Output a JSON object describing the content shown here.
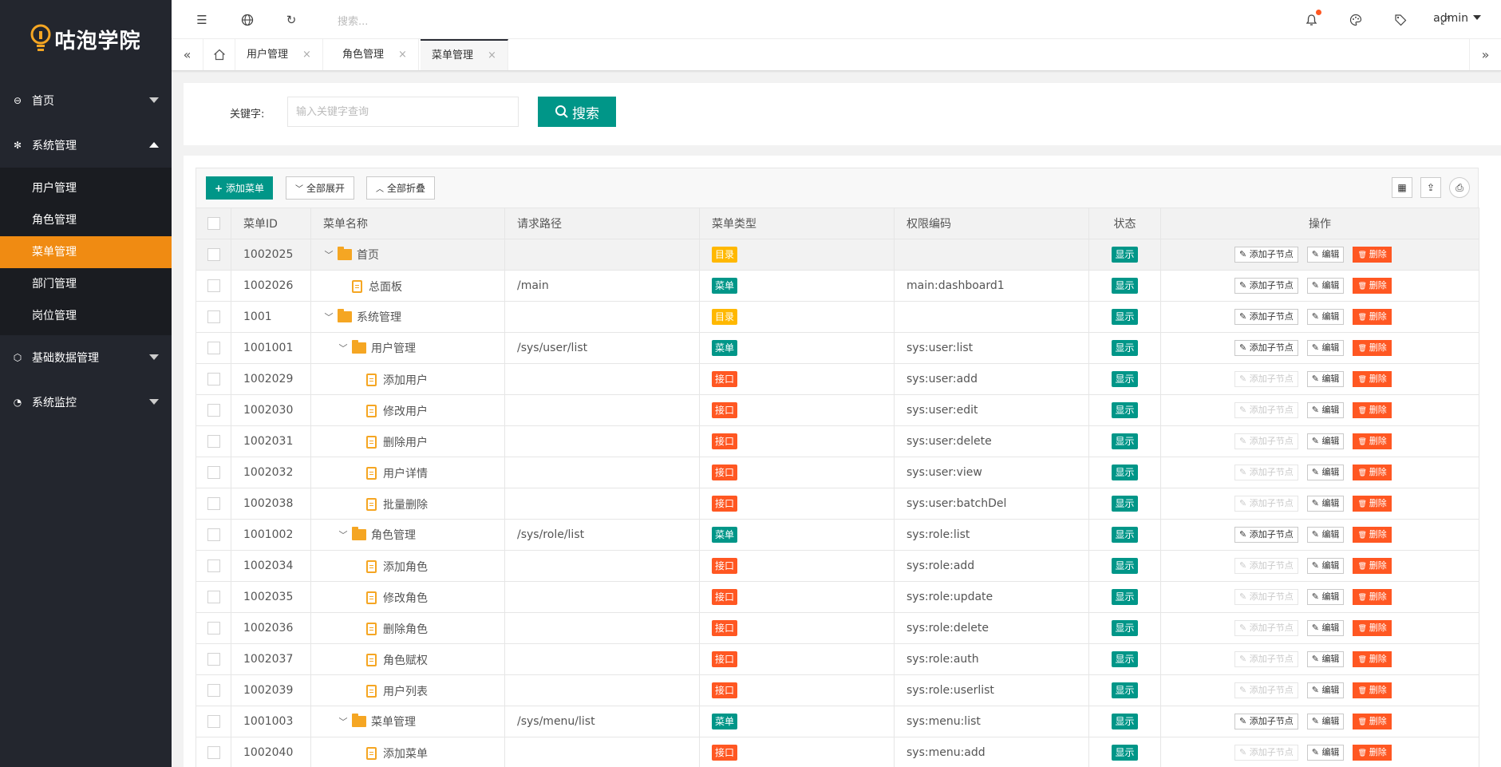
{
  "brand": {
    "name": "咕泡学院"
  },
  "sidebar": {
    "items": [
      {
        "label": "首页",
        "icon": "home-icon"
      },
      {
        "label": "系统管理",
        "icon": "gear-icon",
        "expanded": true,
        "children": [
          {
            "label": "用户管理"
          },
          {
            "label": "角色管理"
          },
          {
            "label": "菜单管理",
            "active": true
          },
          {
            "label": "部门管理"
          },
          {
            "label": "岗位管理"
          }
        ]
      },
      {
        "label": "基础数据管理",
        "icon": "cube-icon"
      },
      {
        "label": "系统监控",
        "icon": "dashboard-icon"
      }
    ]
  },
  "topbar": {
    "search_placeholder": "搜索...",
    "user": "admin"
  },
  "tabs": [
    {
      "label": "用户管理",
      "close": "×"
    },
    {
      "label": "角色管理",
      "close": "×"
    },
    {
      "label": "菜单管理",
      "close": "×",
      "active": true
    }
  ],
  "search": {
    "label": "关键字:",
    "placeholder": "输入关键字查询",
    "button": "搜索"
  },
  "toolbar": {
    "add": "添加菜单",
    "expand": "全部展开",
    "collapse": "全部折叠"
  },
  "table": {
    "headers": [
      "菜单ID",
      "菜单名称",
      "请求路径",
      "菜单类型",
      "权限编码",
      "状态",
      "操作"
    ],
    "ops": {
      "add_child": "添加子节点",
      "edit": "编辑",
      "delete": "删除"
    },
    "rows": [
      {
        "id": "1002025",
        "name": "首页",
        "path": "",
        "type": "目录",
        "kind": "dir",
        "perm": "",
        "status": "显示",
        "level": 0,
        "folder": true,
        "add_enabled": true
      },
      {
        "id": "1002026",
        "name": "总面板",
        "path": "/main",
        "type": "菜单",
        "kind": "menu",
        "perm": "main:dashboard1",
        "status": "显示",
        "level": 1,
        "folder": false,
        "add_enabled": true
      },
      {
        "id": "1001",
        "name": "系统管理",
        "path": "",
        "type": "目录",
        "kind": "dir",
        "perm": "",
        "status": "显示",
        "level": 0,
        "folder": true,
        "add_enabled": true
      },
      {
        "id": "1001001",
        "name": "用户管理",
        "path": "/sys/user/list",
        "type": "菜单",
        "kind": "menu",
        "perm": "sys:user:list",
        "status": "显示",
        "level": 1,
        "folder": true,
        "add_enabled": true
      },
      {
        "id": "1002029",
        "name": "添加用户",
        "path": "",
        "type": "接口",
        "kind": "api",
        "perm": "sys:user:add",
        "status": "显示",
        "level": 2,
        "folder": false,
        "add_enabled": false
      },
      {
        "id": "1002030",
        "name": "修改用户",
        "path": "",
        "type": "接口",
        "kind": "api",
        "perm": "sys:user:edit",
        "status": "显示",
        "level": 2,
        "folder": false,
        "add_enabled": false
      },
      {
        "id": "1002031",
        "name": "删除用户",
        "path": "",
        "type": "接口",
        "kind": "api",
        "perm": "sys:user:delete",
        "status": "显示",
        "level": 2,
        "folder": false,
        "add_enabled": false
      },
      {
        "id": "1002032",
        "name": "用户详情",
        "path": "",
        "type": "接口",
        "kind": "api",
        "perm": "sys:user:view",
        "status": "显示",
        "level": 2,
        "folder": false,
        "add_enabled": false
      },
      {
        "id": "1002038",
        "name": "批量删除",
        "path": "",
        "type": "接口",
        "kind": "api",
        "perm": "sys:user:batchDel",
        "status": "显示",
        "level": 2,
        "folder": false,
        "add_enabled": false
      },
      {
        "id": "1001002",
        "name": "角色管理",
        "path": "/sys/role/list",
        "type": "菜单",
        "kind": "menu",
        "perm": "sys:role:list",
        "status": "显示",
        "level": 1,
        "folder": true,
        "add_enabled": true
      },
      {
        "id": "1002034",
        "name": "添加角色",
        "path": "",
        "type": "接口",
        "kind": "api",
        "perm": "sys:role:add",
        "status": "显示",
        "level": 2,
        "folder": false,
        "add_enabled": false
      },
      {
        "id": "1002035",
        "name": "修改角色",
        "path": "",
        "type": "接口",
        "kind": "api",
        "perm": "sys:role:update",
        "status": "显示",
        "level": 2,
        "folder": false,
        "add_enabled": false
      },
      {
        "id": "1002036",
        "name": "删除角色",
        "path": "",
        "type": "接口",
        "kind": "api",
        "perm": "sys:role:delete",
        "status": "显示",
        "level": 2,
        "folder": false,
        "add_enabled": false
      },
      {
        "id": "1002037",
        "name": "角色赋权",
        "path": "",
        "type": "接口",
        "kind": "api",
        "perm": "sys:role:auth",
        "status": "显示",
        "level": 2,
        "folder": false,
        "add_enabled": false
      },
      {
        "id": "1002039",
        "name": "用户列表",
        "path": "",
        "type": "接口",
        "kind": "api",
        "perm": "sys:role:userlist",
        "status": "显示",
        "level": 2,
        "folder": false,
        "add_enabled": false
      },
      {
        "id": "1001003",
        "name": "菜单管理",
        "path": "/sys/menu/list",
        "type": "菜单",
        "kind": "menu",
        "perm": "sys:menu:list",
        "status": "显示",
        "level": 1,
        "folder": true,
        "add_enabled": true
      },
      {
        "id": "1002040",
        "name": "添加菜单",
        "path": "",
        "type": "接口",
        "kind": "api",
        "perm": "sys:menu:add",
        "status": "显示",
        "level": 2,
        "folder": false,
        "add_enabled": false
      }
    ]
  },
  "colors": {
    "accent": "#009688",
    "active_nav": "#f08b12",
    "danger": "#ff5722",
    "warn": "#ffb800",
    "sidebar": "#23262e"
  }
}
